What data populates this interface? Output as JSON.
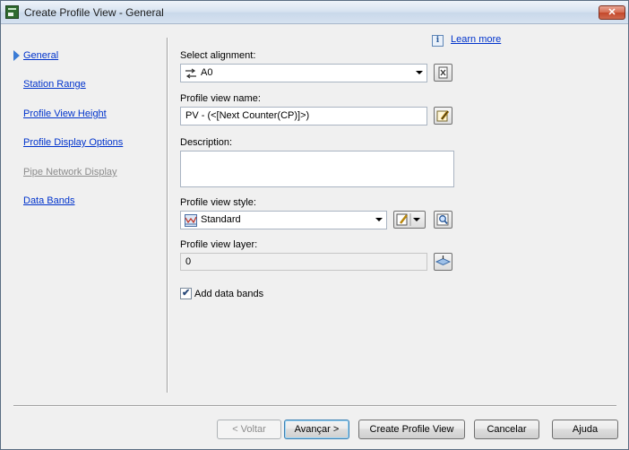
{
  "window": {
    "title": "Create Profile View - General",
    "close_glyph": "✕"
  },
  "nav": {
    "items": [
      {
        "label": "General",
        "state": "active"
      },
      {
        "label": "Station Range",
        "state": "enabled"
      },
      {
        "label": "Profile View Height",
        "state": "enabled"
      },
      {
        "label": "Profile Display Options",
        "state": "enabled"
      },
      {
        "label": "Pipe Network Display",
        "state": "disabled"
      },
      {
        "label": "Data Bands",
        "state": "enabled"
      }
    ]
  },
  "help": {
    "learn_more": "Learn more",
    "info_glyph": "i"
  },
  "form": {
    "alignment": {
      "label": "Select alignment:",
      "value": "A0"
    },
    "view_name": {
      "label": "Profile view name:",
      "value": "PV - (<[Next Counter(CP)]>)"
    },
    "description": {
      "label": "Description:",
      "value": ""
    },
    "style": {
      "label": "Profile view style:",
      "value": "Standard"
    },
    "layer": {
      "label": "Profile view layer:",
      "value": "0"
    },
    "add_bands": {
      "label": "Add data bands",
      "checked": true,
      "glyph": "✔"
    }
  },
  "buttons": {
    "back": "< Voltar",
    "next": "Avançar >",
    "create": "Create Profile View",
    "cancel": "Cancelar",
    "help": "Ajuda"
  },
  "colors": {
    "link": "#0033cc",
    "disabled_text": "#8c8c8c",
    "nav_marker": "#3a7bd5"
  }
}
